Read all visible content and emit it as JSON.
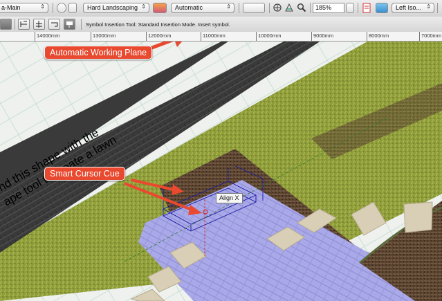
{
  "toolbar": {
    "class_select": "a-Main",
    "layer_select": "Hard Landscaping",
    "plane_select": "Automatic",
    "zoom": "185%",
    "view_select": "Left Iso..."
  },
  "mode_bar": {
    "status_text": "Symbol Insertion Tool: Standard Insertion Mode. Insert symbol."
  },
  "ruler": {
    "labels": [
      "14000mm",
      "13000mm",
      "12000mm",
      "11000mm",
      "10000mm",
      "9000mm",
      "8000mm",
      "7000mm"
    ]
  },
  "canvas": {
    "callout_plane": "Automatic Working Plane",
    "callout_cursor": "Smart Cursor Cue",
    "cue_label": "Align X",
    "lawn_text_line1": "nd this shape with the",
    "lawn_text_line2": "ape tool to create a lawn"
  },
  "colors": {
    "callout": "#e8492f",
    "grass": "#8f9e3a",
    "paving": "#a9a8e8",
    "road": "#3a3a3a",
    "gravel": "#5c4430"
  },
  "icons": [
    "chevron-updown-icon",
    "layers-icon",
    "working-plane-icon",
    "sheet-icon",
    "flyover-icon",
    "walkthrough-icon",
    "zoom-icon",
    "page-icon",
    "view-cube-icon",
    "insertion-mode-icons"
  ]
}
